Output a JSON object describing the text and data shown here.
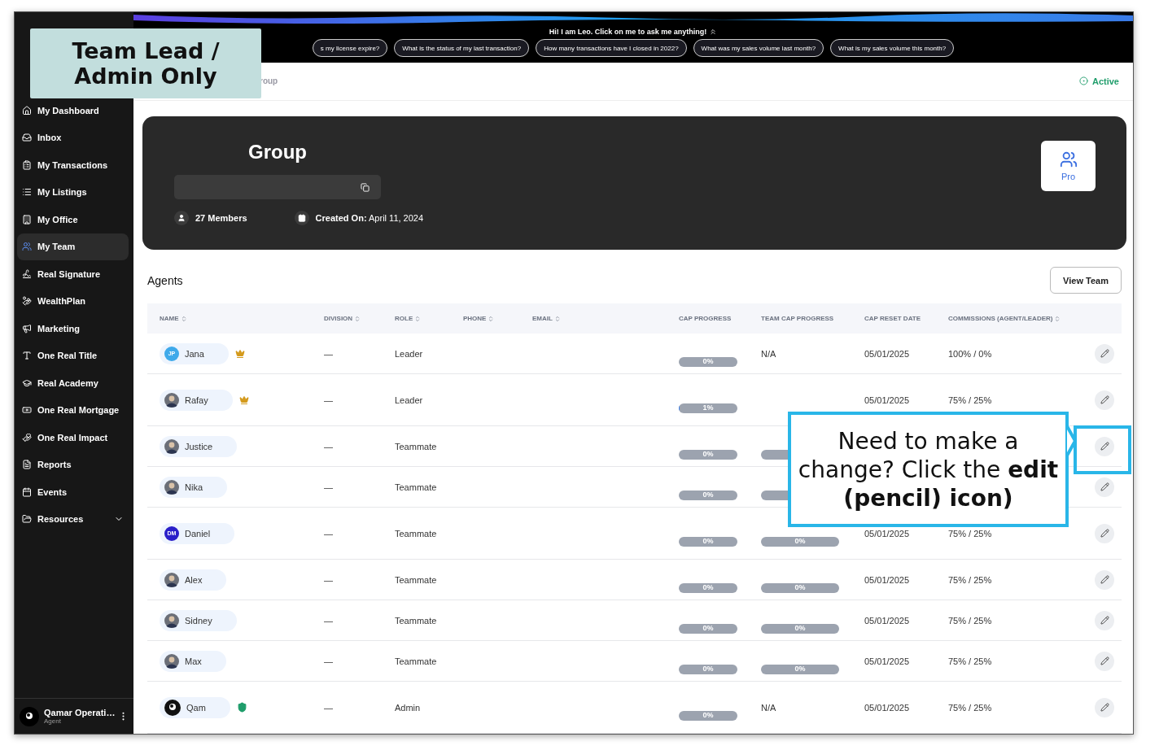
{
  "overlay_badge": {
    "text": "Team Lead / Admin Only"
  },
  "banner": {
    "greeting": "Hi! I am Leo. Click on me to ask me anything!",
    "suggestions": [
      "s my license expire?",
      "What is the status of my last transaction?",
      "How many transactions have I closed in 2022?",
      "What was my sales volume last month?",
      "What is my sales volume this month?"
    ]
  },
  "breadcrumb": "roup",
  "status": "Active",
  "sidebar": {
    "items": [
      {
        "label": "My Dashboard",
        "kind": "link",
        "selected": false
      },
      {
        "label": "Inbox",
        "kind": "link",
        "selected": false
      },
      {
        "label": "My Transactions",
        "kind": "link",
        "selected": false
      },
      {
        "label": "My Listings",
        "kind": "link",
        "selected": false
      },
      {
        "label": "My Office",
        "kind": "link",
        "selected": false
      },
      {
        "label": "My Team",
        "kind": "link",
        "selected": true
      },
      {
        "label": "Real Signature",
        "kind": "link",
        "selected": false
      },
      {
        "label": "WealthPlan",
        "kind": "link",
        "selected": false
      },
      {
        "label": "Marketing",
        "kind": "link",
        "selected": false
      },
      {
        "label": "One Real Title",
        "kind": "link",
        "selected": false
      },
      {
        "label": "Real Academy",
        "kind": "link",
        "selected": false
      },
      {
        "label": "One Real Mortgage",
        "kind": "link",
        "selected": false
      },
      {
        "label": "One Real Impact",
        "kind": "link",
        "selected": false
      },
      {
        "label": "Reports",
        "kind": "link",
        "selected": false
      },
      {
        "label": "Events",
        "kind": "link",
        "selected": false
      },
      {
        "label": "Resources",
        "kind": "group",
        "selected": false
      }
    ],
    "user": {
      "name": "Qamar Operati…",
      "role": "Agent"
    }
  },
  "group": {
    "title": "Group",
    "members": "27 Members",
    "created_label": "Created On:",
    "created_date": "April 11, 2024",
    "plan": "Pro"
  },
  "agents": {
    "title": "Agents",
    "view_button": "View Team",
    "columns": [
      {
        "label": "NAME",
        "sortable": true
      },
      {
        "label": "DIVISION",
        "sortable": true
      },
      {
        "label": "ROLE",
        "sortable": true
      },
      {
        "label": "PHONE",
        "sortable": true
      },
      {
        "label": "EMAIL",
        "sortable": true
      },
      {
        "label": "CAP PROGRESS",
        "sortable": false
      },
      {
        "label": "TEAM CAP PROGRESS",
        "sortable": false
      },
      {
        "label": "CAP RESET DATE",
        "sortable": false
      },
      {
        "label": "COMMISSIONS (AGENT/LEADER)",
        "sortable": true
      }
    ],
    "rows": [
      {
        "name": "Jana",
        "avatar": {
          "kind": "initials",
          "initials": "JP",
          "color": "#3ea9ea"
        },
        "badge": {
          "kind": "crown"
        },
        "division": "—",
        "role": "Leader",
        "cap": {
          "label": "0%",
          "level": 0
        },
        "team_cap": {
          "kind": "text",
          "text": "N/A"
        },
        "date": "05/01/2025",
        "commission": "100% / 0%",
        "tall": false
      },
      {
        "name": "Rafay",
        "avatar": {
          "kind": "photo"
        },
        "badge": {
          "kind": "crown"
        },
        "division": "—",
        "role": "Leader",
        "cap": {
          "label": "1%",
          "level": 0.01
        },
        "team_cap": {
          "kind": "none"
        },
        "date": "05/01/2025",
        "commission": "75% / 25%",
        "tall": true
      },
      {
        "name": "Justice",
        "avatar": {
          "kind": "photo"
        },
        "division": "—",
        "role": "Teammate",
        "cap": {
          "label": "0%",
          "level": 0
        },
        "team_cap": {
          "kind": "bar",
          "level": 0
        },
        "tall": false
      },
      {
        "name": "Nika",
        "avatar": {
          "kind": "photo"
        },
        "division": "—",
        "role": "Teammate",
        "cap": {
          "label": "0%",
          "level": 0
        },
        "team_cap": {
          "kind": "bar",
          "level": 0
        },
        "tall": false
      },
      {
        "name": "Daniel",
        "avatar": {
          "kind": "initials",
          "initials": "DM",
          "color": "#2a1fc9"
        },
        "division": "—",
        "role": "Teammate",
        "cap": {
          "label": "0%",
          "level": 0
        },
        "team_cap": {
          "kind": "bar",
          "level": 0,
          "label": "0%"
        },
        "date": "05/01/2025",
        "commission": "75% / 25%",
        "tall": true
      },
      {
        "name": "Alex",
        "avatar": {
          "kind": "photo"
        },
        "division": "—",
        "role": "Teammate",
        "cap": {
          "label": "0%",
          "level": 0
        },
        "team_cap": {
          "kind": "bar",
          "level": 0,
          "label": "0%"
        },
        "date": "05/01/2025",
        "commission": "75% / 25%",
        "tall": false
      },
      {
        "name": "Sidney",
        "avatar": {
          "kind": "photo"
        },
        "division": "—",
        "role": "Teammate",
        "cap": {
          "label": "0%",
          "level": 0
        },
        "team_cap": {
          "kind": "bar",
          "level": 0,
          "label": "0%"
        },
        "date": "05/01/2025",
        "commission": "75% / 25%",
        "tall": false
      },
      {
        "name": "Max",
        "avatar": {
          "kind": "photo"
        },
        "division": "—",
        "role": "Teammate",
        "cap": {
          "label": "0%",
          "level": 0
        },
        "team_cap": {
          "kind": "bar",
          "level": 0,
          "label": "0%"
        },
        "date": "05/01/2025",
        "commission": "75% / 25%",
        "tall": false
      },
      {
        "name": "Qam",
        "avatar": {
          "kind": "logo"
        },
        "badge": {
          "kind": "shield"
        },
        "division": "—",
        "role": "Admin",
        "cap": {
          "label": "0%",
          "level": 0
        },
        "team_cap": {
          "kind": "text",
          "text": "N/A"
        },
        "date": "05/01/2025",
        "commission": "75% / 25%",
        "tall": true
      }
    ]
  },
  "callout": {
    "text": "Need to make a change? Click the **edit (pencil) icon)**"
  }
}
